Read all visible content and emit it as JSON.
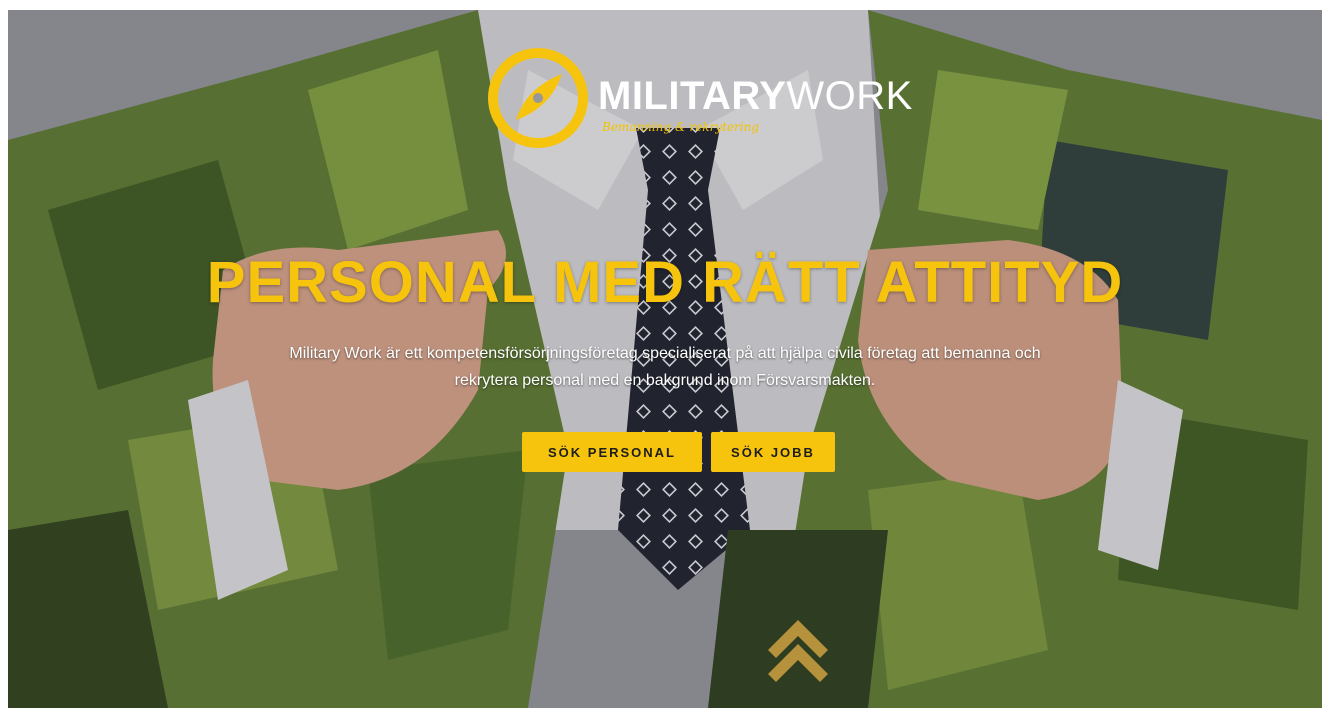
{
  "brand": {
    "name_bold": "MILITARY",
    "name_light": "WORK",
    "tagline": "Bemanning & rekrytering",
    "accent_color": "#f6c40c",
    "logo_icon": "compass-icon"
  },
  "hero": {
    "background_image": "man-in-camouflage-jacket-with-tie",
    "headline": "PERSONAL MED RÄTT ATTITYD",
    "lead": "Military Work är ett kompetensförsörjningsföretag specialiserat på att hjälpa civila företag att bemanna och rekrytera personal med en bakgrund inom Försvarsmakten.",
    "buttons": [
      {
        "label": "SÖK PERSONAL"
      },
      {
        "label": "SÖK JOBB"
      }
    ]
  }
}
